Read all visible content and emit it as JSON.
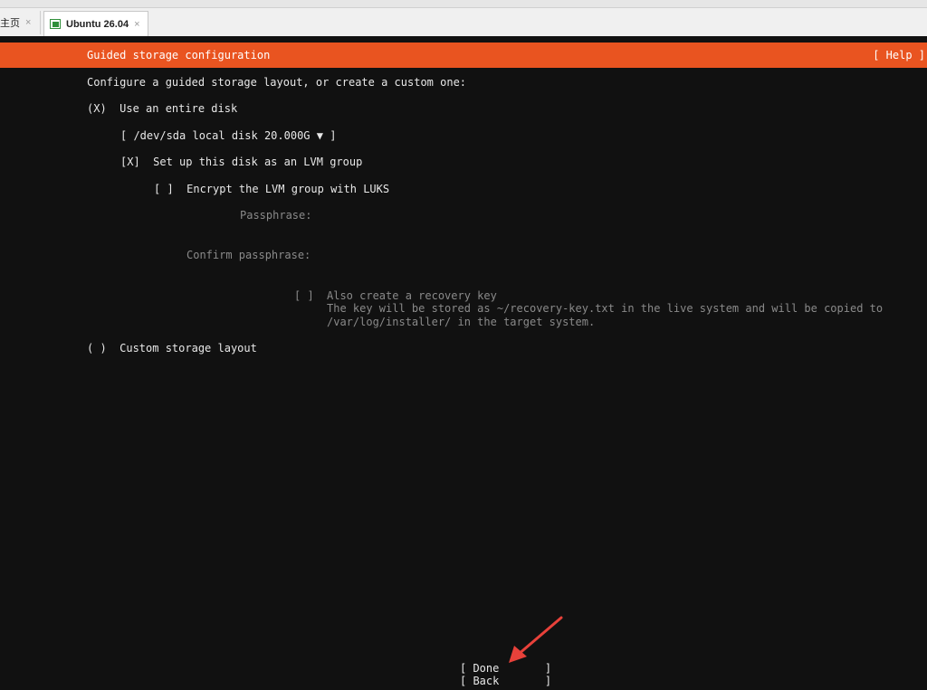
{
  "tabs": {
    "home_label": "主页",
    "active_label": "Ubuntu 26.04",
    "close_glyph": "×"
  },
  "installer": {
    "header_title": "Guided storage configuration",
    "help_label": "[ Help ]",
    "intro": "Configure a guided storage layout, or create a custom one:",
    "entire_disk_option": "(X)  Use an entire disk",
    "disk_select": "[ /dev/sda local disk 20.000G ▼ ]",
    "lvm_checkbox": "[X]  Set up this disk as an LVM group",
    "encrypt_checkbox": "[ ]  Encrypt the LVM group with LUKS",
    "passphrase_label": "Passphrase:",
    "confirm_passphrase_label": "Confirm passphrase:",
    "recovery_checkbox": "[ ]",
    "recovery_label": "Also create a recovery key",
    "recovery_desc_1": "The key will be stored as ~/recovery-key.txt in the live system and will be copied to",
    "recovery_desc_2": "/var/log/installer/ in the target system.",
    "custom_option": "( )  Custom storage layout",
    "done_button": "[ Done       ]",
    "back_button": "[ Back       ]"
  },
  "colors": {
    "header_bg": "#e95420",
    "terminal_bg": "#111111",
    "arrow": "#e8413a"
  }
}
